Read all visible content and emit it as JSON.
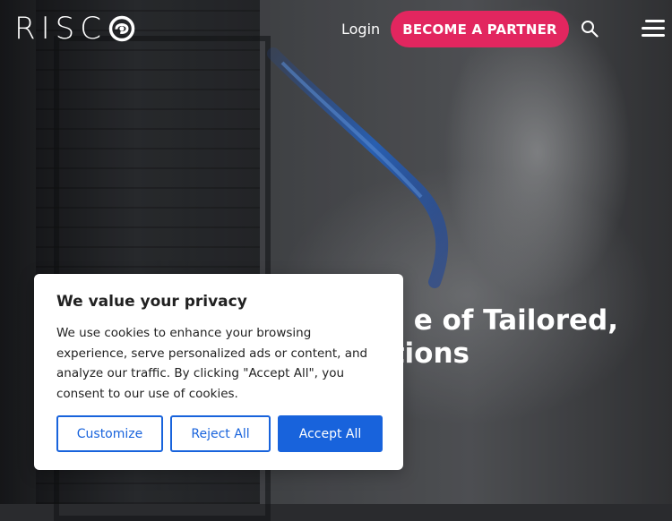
{
  "header": {
    "logo_text": "RISC",
    "login_label": "Login",
    "partner_button_label": "BECOME A PARTNER",
    "icons": {
      "search": "search-icon",
      "menu": "hamburger-menu-icon"
    },
    "accent_color": "#e2265f"
  },
  "hero": {
    "headline_line1": "e of Tailored,",
    "headline_line2": "tions"
  },
  "cookie_banner": {
    "title": "We value your privacy",
    "body": "We use cookies to enhance your browsing experience, serve personalized ads or content, and analyze our traffic. By clicking \"Accept All\", you consent to our use of cookies.",
    "buttons": {
      "customize": "Customize",
      "reject_all": "Reject All",
      "accept_all": "Accept All"
    },
    "button_color": "#1863dc"
  }
}
